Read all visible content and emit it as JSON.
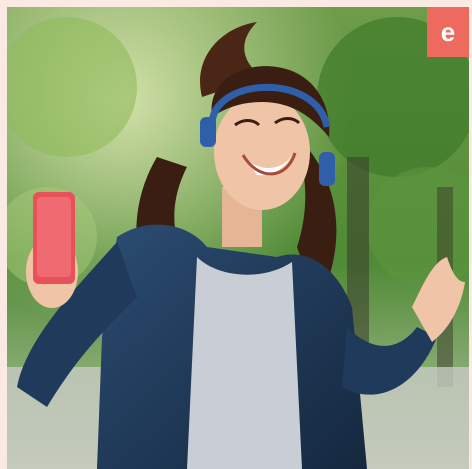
{
  "badge": {
    "letter": "e",
    "color": "#ee6a5e"
  },
  "photo": {
    "subject": "woman-dancing-with-headphones-and-phone",
    "colors": {
      "foliage": "#4f8a35",
      "foliage_light": "#a9c97a",
      "hair": "#3b1e12",
      "skin": "#f0c4a6",
      "jacket": "#1f3a5a",
      "shirt": "#c9ced6",
      "phone": "#e8505a",
      "headphones": "#2f5fa8"
    }
  }
}
